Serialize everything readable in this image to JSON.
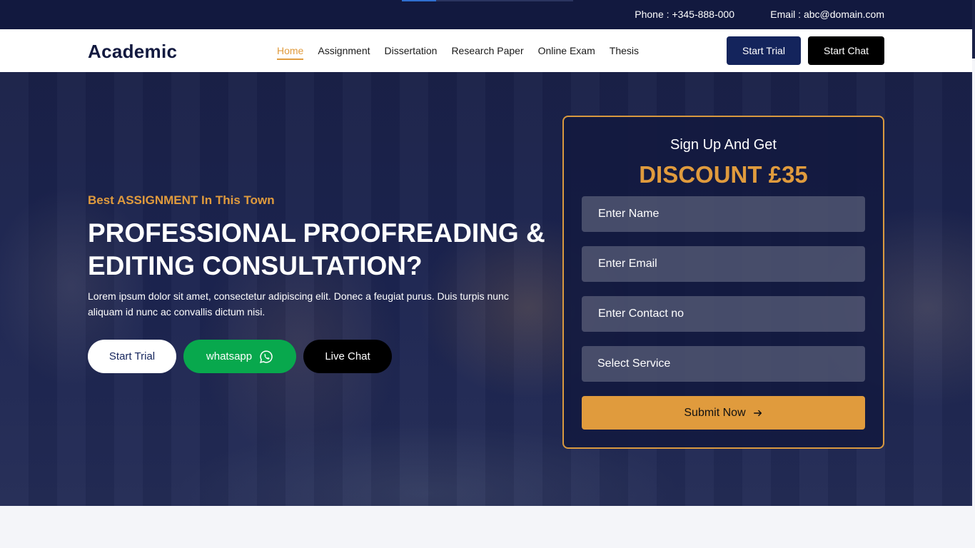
{
  "topbar": {
    "phone": "Phone : +345-888-000",
    "email": "Email : abc@domain.com",
    "progress_fraction": 0.2
  },
  "navbar": {
    "logo": "Academic",
    "items": [
      {
        "label": "Home",
        "active": true
      },
      {
        "label": "Assignment"
      },
      {
        "label": "Dissertation"
      },
      {
        "label": "Research Paper"
      },
      {
        "label": "Online Exam"
      },
      {
        "label": "Thesis"
      }
    ],
    "start_trial": "Start Trial",
    "start_chat": "Start Chat"
  },
  "hero": {
    "subtitle": "Best ASSIGNMENT In This Town",
    "headline": "PROFESSIONAL PROOFREADING & EDITING CONSULTATION?",
    "description": "Lorem ipsum dolor sit amet, consectetur adipiscing elit. Donec a feugiat purus. Duis turpis nunc aliquam id nunc ac convallis dictum nisi.",
    "buttons": {
      "trial": "Start Trial",
      "whatsapp": "whatsapp",
      "live_chat": "Live Chat"
    }
  },
  "form": {
    "title": "Sign Up And Get",
    "discount": "DISCOUNT £35",
    "name_placeholder": "Enter Name",
    "email_placeholder": "Enter Email",
    "contact_placeholder": "Enter Contact no",
    "service_select": "Select Service",
    "submit": "Submit Now"
  },
  "colors": {
    "accent": "#e09b3d",
    "navy": "#12193f",
    "whatsapp": "#08a84d"
  }
}
